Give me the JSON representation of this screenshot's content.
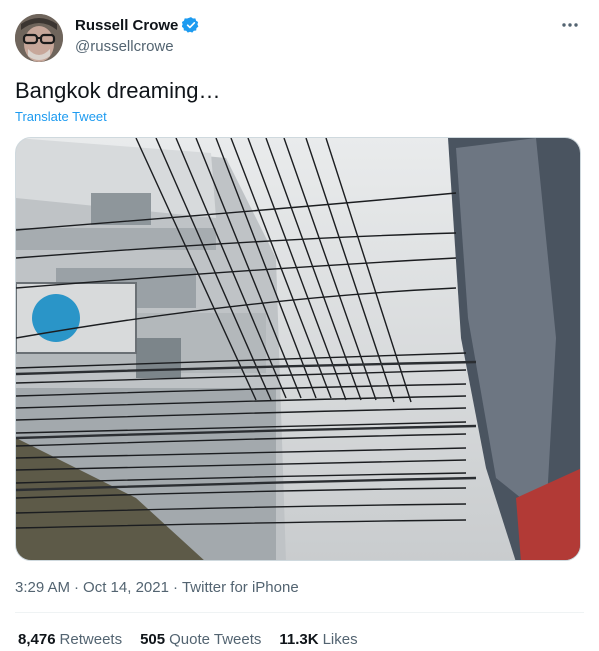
{
  "author": {
    "display_name": "Russell Crowe",
    "handle": "@russellcrowe",
    "verified_icon": "verified-badge-icon",
    "accent_color": "#1d9bf0"
  },
  "more_icon": "more-horizontal-icon",
  "tweet": {
    "text": "Bangkok dreaming…",
    "translate_label": "Translate Tweet",
    "media_alt": ""
  },
  "meta": {
    "time": "3:29 AM",
    "separator1": "·",
    "date": "Oct 14, 2021",
    "separator2": "·",
    "source": "Twitter for iPhone"
  },
  "stats": {
    "retweets_count": "8,476",
    "retweets_label": "Retweets",
    "quotes_count": "505",
    "quotes_label": "Quote Tweets",
    "likes_count": "11.3K",
    "likes_label": "Likes"
  }
}
